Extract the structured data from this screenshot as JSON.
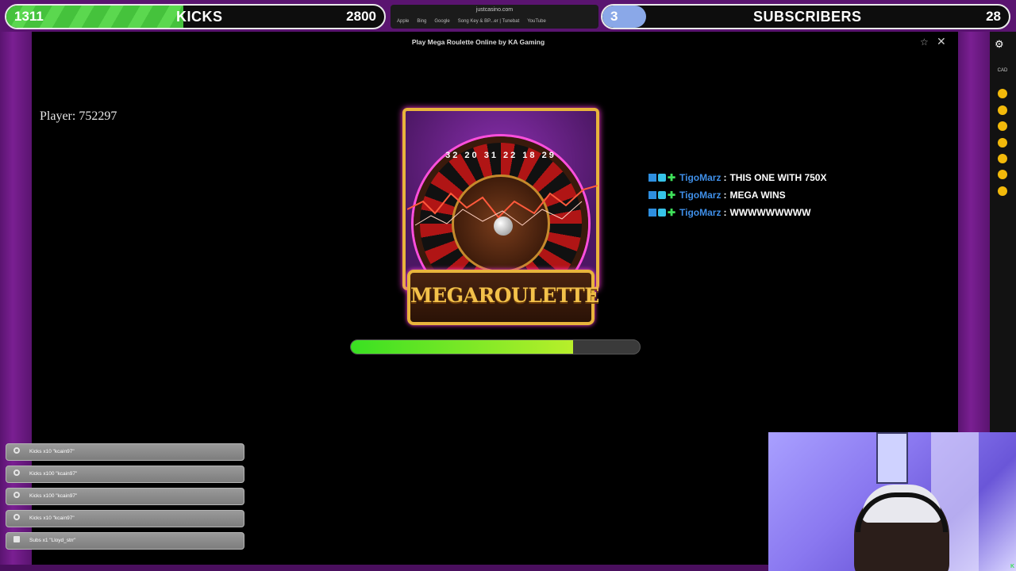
{
  "overlay": {
    "kicks_goal": {
      "current": "1311",
      "label": "KICKS",
      "target": "2800",
      "progress": 0.468
    },
    "subs_goal": {
      "current": "3",
      "label": "SUBSCRIBERS",
      "target": "28",
      "progress": 0.107
    }
  },
  "browser": {
    "url": "justcasino.com",
    "bookmarks": [
      "Apple",
      "Bing",
      "Google",
      "Song Key & BP...er | Tunebat",
      "YouTube"
    ]
  },
  "game": {
    "title": "Play Mega Roulette Online by KA Gaming",
    "player_label": "Player: 752297",
    "logo_text": "MEGAROULETTE",
    "wheel_numbers": "32 20 31 22 18 29",
    "loading_progress": 0.77
  },
  "sidebar": {
    "currency": "CAD"
  },
  "chat": [
    {
      "user": "TigoMarz",
      "message": "THIS ONE WITH 750X"
    },
    {
      "user": "TigoMarz",
      "message": "MEGA WINS"
    },
    {
      "user": "TigoMarz",
      "message": "WWWWWWWWW"
    }
  ],
  "alerts": [
    {
      "text": "Kicks x10 \"kcain97\"",
      "icon": "kick-icon"
    },
    {
      "text": "Kicks x100 \"kcain97\"",
      "icon": "kick-icon"
    },
    {
      "text": "Kicks x100 \"kcain97\"",
      "icon": "kick-icon"
    },
    {
      "text": "Kicks x10 \"kcain97\"",
      "icon": "kick-icon"
    },
    {
      "text": "Subs x1 \"Lloyd_strr\"",
      "icon": "gift-icon"
    }
  ],
  "webcam": {
    "badge": "K"
  },
  "colors": {
    "frame_purple": "#5a1470",
    "kicks_green": "#45c23c",
    "subs_blue": "#8aa8e8",
    "chat_user": "#3f8fe8",
    "progress_green": "#39e022",
    "coin_gold": "#f2b90a"
  }
}
